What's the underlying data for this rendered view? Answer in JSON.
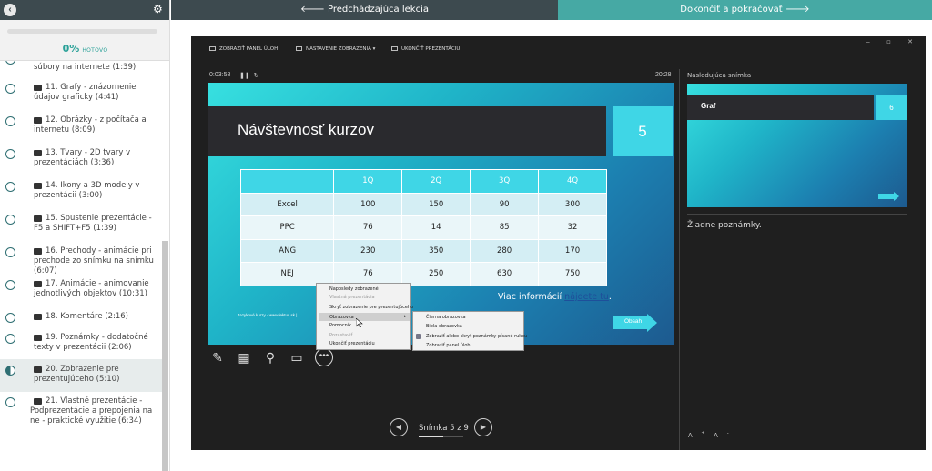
{
  "sidebar": {
    "progress_pct": "0%",
    "progress_label": "HOTOVO",
    "progress_value": 0,
    "lessons": [
      {
        "title": "súbory na internete (1:39)",
        "state": "todo"
      },
      {
        "title": "11. Grafy - znázornenie údajov graficky (4:41)",
        "state": "todo"
      },
      {
        "title": "12. Obrázky - z počítača a internetu (8:09)",
        "state": "todo"
      },
      {
        "title": "13. Tvary - 2D tvary v prezentáciách (3:36)",
        "state": "todo"
      },
      {
        "title": "14. Ikony a 3D modely v prezentácii (3:00)",
        "state": "todo"
      },
      {
        "title": "15. Spustenie prezentácie - F5 a SHIFT+F5 (1:39)",
        "state": "todo"
      },
      {
        "title": "16. Prechody - animácie pri prechode zo snímku na snímku (6:07)",
        "state": "todo"
      },
      {
        "title": "17. Animácie - animovanie jednotlivých objektov (10:31)",
        "state": "todo"
      },
      {
        "title": "18. Komentáre (2:16)",
        "state": "todo"
      },
      {
        "title": "19. Poznámky - dodatočné texty v prezentácii (2:06)",
        "state": "todo"
      },
      {
        "title": "20. Zobrazenie pre prezentujúceho (5:10)",
        "state": "active"
      },
      {
        "title": "21. Vlastné prezentácie - Podprezentácie a prepojenia na ne - praktické využitie (6:34)",
        "state": "todo"
      }
    ]
  },
  "nav": {
    "prev_label": "Predchádzajúca lekcia",
    "next_label": "Dokončiť a pokračovať"
  },
  "presenter": {
    "toolbar": {
      "taskbar": "ZOBRAZIŤ PANEL ÚLOH",
      "display_settings": "NASTAVENIE ZOBRAZENIA ▾",
      "end_show": "UKONČIŤ PREZENTÁCIU"
    },
    "timer": "0:03:58",
    "clock": "20:28",
    "slide": {
      "title": "Návštevnosť kurzov",
      "number": "5",
      "table": {
        "headers": [
          "",
          "1Q",
          "2Q",
          "3Q",
          "4Q"
        ],
        "rows": [
          [
            "Excel",
            "100",
            "150",
            "90",
            "300"
          ],
          [
            "PPC",
            "76",
            "14",
            "85",
            "32"
          ],
          [
            "ANG",
            "230",
            "350",
            "280",
            "170"
          ],
          [
            "NEJ",
            "76",
            "250",
            "630",
            "750"
          ]
        ]
      },
      "more_text": "Viac informácií",
      "more_link": "nájdete tu",
      "more_end": ".",
      "footer": "Jazykové kurzy - www.lektus.sk |",
      "button": "Obsah"
    },
    "context_menu": {
      "items": [
        {
          "label": "Naposledy zobrazené",
          "disabled": false
        },
        {
          "label": "Vlastná prezentácia",
          "disabled": true
        },
        {
          "label": "Skryť zobrazenie pre prezentujúceho",
          "disabled": false
        },
        {
          "label": "Obrazovka",
          "disabled": false
        },
        {
          "label": "Pomocník",
          "disabled": false
        },
        {
          "label": "Pozastaviť",
          "disabled": true
        },
        {
          "label": "Ukončiť prezentáciu",
          "disabled": false
        }
      ],
      "submenu": [
        "Čierna obrazovka",
        "Biela obrazovka",
        "Zobraziť alebo skryť poznámky písané rukou",
        "Zobraziť panel úloh"
      ]
    },
    "slide_counter": "Snímka 5 z 9",
    "slide_progress": 0.556,
    "next_slide_label": "Nasledujúca snímka",
    "next_slide": {
      "title": "Graf",
      "number": "6"
    },
    "notes": "Žiadne poznámky."
  }
}
